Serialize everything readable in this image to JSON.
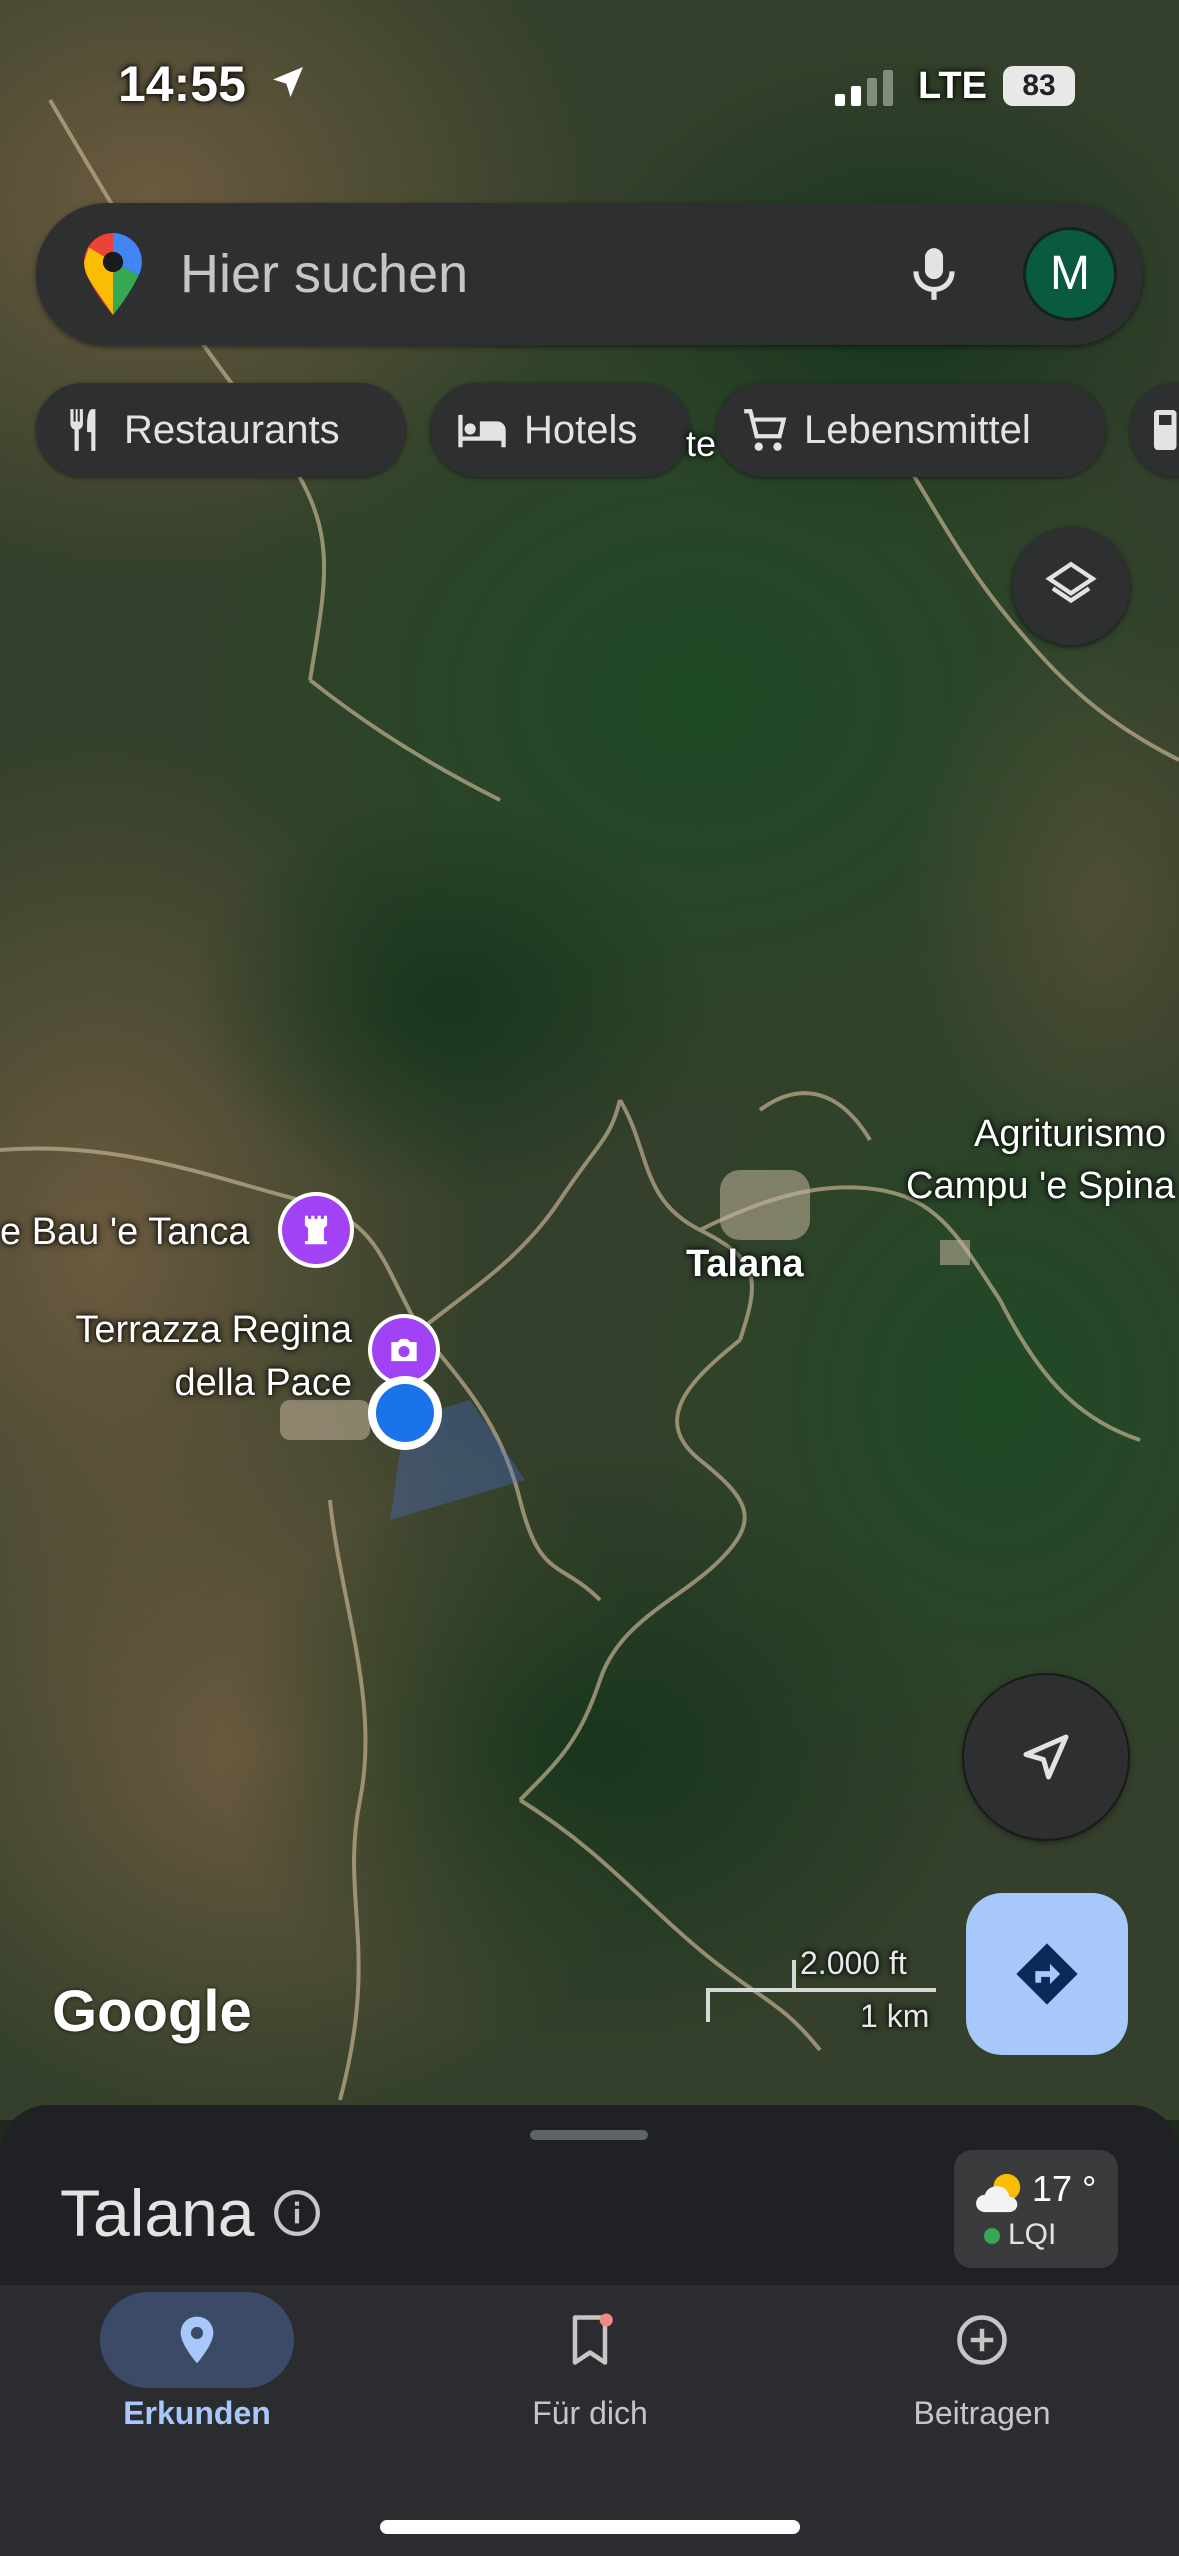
{
  "status_bar": {
    "time": "14:55",
    "network": "LTE",
    "battery": "83"
  },
  "search": {
    "placeholder": "Hier suchen",
    "avatar_letter": "M"
  },
  "chips": [
    {
      "label": "Restaurants",
      "icon": "fork-knife-icon"
    },
    {
      "label": "Hotels",
      "icon": "bed-icon"
    },
    {
      "label": "Lebensmittel",
      "icon": "cart-icon"
    }
  ],
  "map": {
    "labels": {
      "place_1": "e Bau 'e Tanca",
      "place_2_line1": "Terrazza Regina",
      "place_2_line2": "della Pace",
      "town": "Talana",
      "agri_line1": "Agriturismo",
      "agri_line2": "Campu 'e Spina",
      "partial_text": "te"
    },
    "logo": "Google",
    "scale": {
      "imperial": "2.000 ft",
      "metric": "1 km"
    }
  },
  "sheet": {
    "title": "Talana",
    "weather_temp": "17 °",
    "weather_aqi": "LQI"
  },
  "nav": [
    {
      "label": "Erkunden",
      "active": true
    },
    {
      "label": "Für dich",
      "active": false
    },
    {
      "label": "Beitragen",
      "active": false
    }
  ],
  "colors": {
    "accent": "#a8c7fa",
    "active_pill": "#3b4a66",
    "poi_purple": "#a142f4",
    "location_blue": "#1a73e8"
  }
}
